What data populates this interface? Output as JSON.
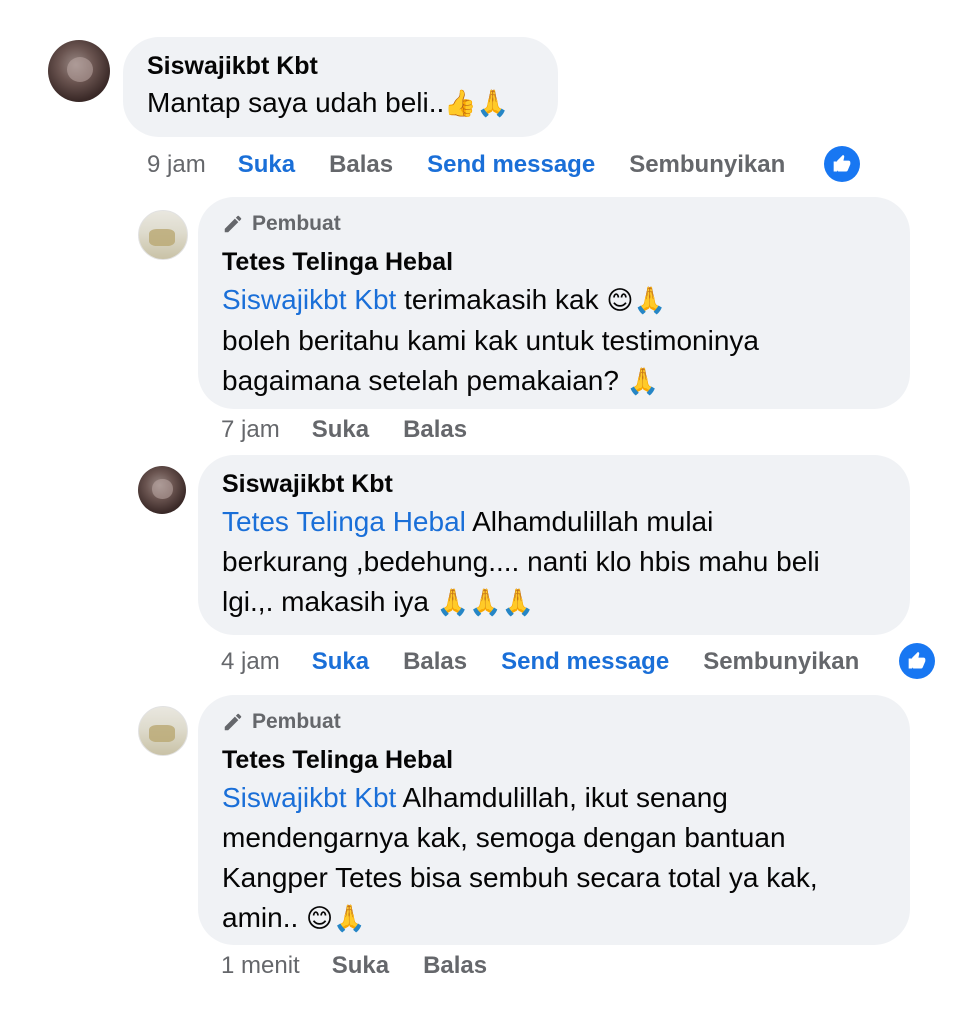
{
  "comments": [
    {
      "author": "Siswajikbt Kbt",
      "text": "Mantap saya udah beli..",
      "emojis": "👍🙏",
      "time": "9 jam",
      "actions": [
        "Suka",
        "Balas",
        "Send message",
        "Sembunyikan"
      ]
    },
    {
      "badge": "Pembuat",
      "author": "Tetes Telinga Hebal",
      "mention": "Siswajikbt Kbt",
      "line1": " terimakasih kak ",
      "line1_emojis": "😊🙏",
      "line2": "boleh beritahu kami kak untuk testimoninya",
      "line3": "bagaimana setelah pemakaian? ",
      "line3_emojis": "🙏",
      "time": "7 jam",
      "actions": [
        "Suka",
        "Balas"
      ]
    },
    {
      "author": "Siswajikbt Kbt",
      "mention": "Tetes Telinga Hebal",
      "line1": " Alhamdulillah mulai",
      "line2": "berkurang ,bedehung.... nanti klo hbis mahu beli",
      "line3": "lgi.,. makasih iya ",
      "line3_emojis": "🙏🙏🙏",
      "time": "4 jam",
      "actions": [
        "Suka",
        "Balas",
        "Send message",
        "Sembunyikan"
      ]
    },
    {
      "badge": "Pembuat",
      "author": "Tetes Telinga Hebal",
      "mention": "Siswajikbt Kbt",
      "line1": " Alhamdulillah, ikut senang",
      "line2": "mendengarnya kak, semoga dengan bantuan",
      "line3": "Kangper Tetes bisa sembuh secara total ya kak,",
      "line4": "amin.. ",
      "line4_emojis": "😊🙏",
      "time": "1 menit",
      "actions": [
        "Suka",
        "Balas"
      ]
    }
  ],
  "icons": [
    "avatar",
    "pen-icon",
    "like-reaction-icon"
  ],
  "colors": {
    "link": "#1a6fd8",
    "bubble": "#f0f2f5",
    "muted": "#65676b",
    "like": "#1877f2"
  }
}
